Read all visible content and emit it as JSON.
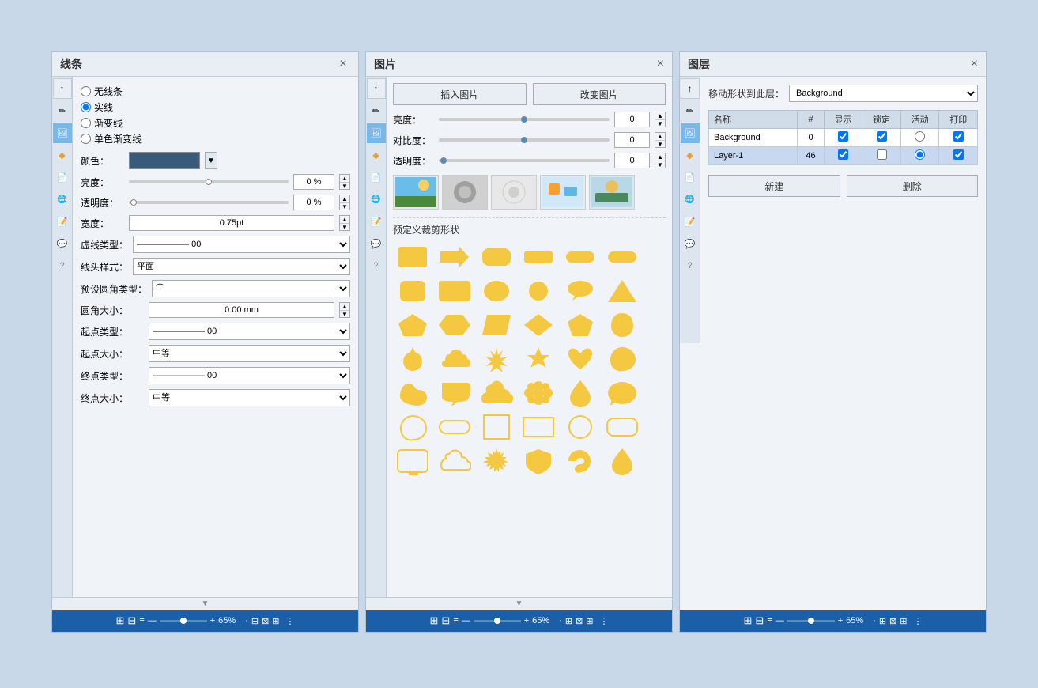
{
  "app": {
    "background_color": "#c8d8e8"
  },
  "panel_lines": {
    "title": "线条",
    "close": "×",
    "radio_options": [
      "无线条",
      "实线",
      "渐变线",
      "单色渐变线"
    ],
    "radio_selected": "实线",
    "color_label": "颜色：",
    "brightness_label": "亮度：",
    "brightness_value": "0 %",
    "opacity_label": "透明度：",
    "opacity_value": "0 %",
    "width_label": "宽度：",
    "width_value": "0.75pt",
    "dash_type_label": "虚线类型：",
    "dash_type_value": "00",
    "line_head_label": "线头样式：",
    "line_head_value": "平面",
    "corner_type_label": "预设圆角类型：",
    "corner_size_label": "圆角大小：",
    "corner_size_value": "0.00 mm",
    "start_type_label": "起点类型：",
    "start_type_value": "00",
    "start_size_label": "起点大小：",
    "start_size_value": "中等",
    "end_type_label": "终点类型：",
    "end_type_value": "00",
    "end_size_label": "终点大小：",
    "end_size_value": "中等"
  },
  "panel_image": {
    "title": "图片",
    "close": "×",
    "insert_btn": "插入图片",
    "change_btn": "改变图片",
    "brightness_label": "亮度：",
    "brightness_value": "0",
    "contrast_label": "对比度：",
    "contrast_value": "0",
    "opacity_label": "透明度：",
    "opacity_value": "0",
    "preset_crop_title": "预定义裁剪形状"
  },
  "panel_layers": {
    "title": "图层",
    "close": "×",
    "move_label": "移动形状到此层：",
    "layer_selected": "Background",
    "table_headers": [
      "名称",
      "#",
      "显示",
      "锁定",
      "活动",
      "打印"
    ],
    "layers": [
      {
        "name": "Background",
        "count": "0",
        "show": true,
        "lock": true,
        "active": false,
        "print": true
      },
      {
        "name": "Layer-1",
        "count": "46",
        "show": true,
        "lock": false,
        "active": true,
        "print": true
      }
    ],
    "new_btn": "新建",
    "delete_btn": "删除"
  },
  "status_bar": {
    "zoom": "65%",
    "icons": [
      "⊞",
      "⊟",
      "≡",
      "⊠",
      "⊞"
    ]
  },
  "icons": {
    "arrow": "→",
    "pencil": "✏",
    "image": "🖼",
    "shape": "◆",
    "grid": "⊞",
    "globe": "🌐",
    "doc": "📄",
    "chat": "💬",
    "help": "?"
  }
}
